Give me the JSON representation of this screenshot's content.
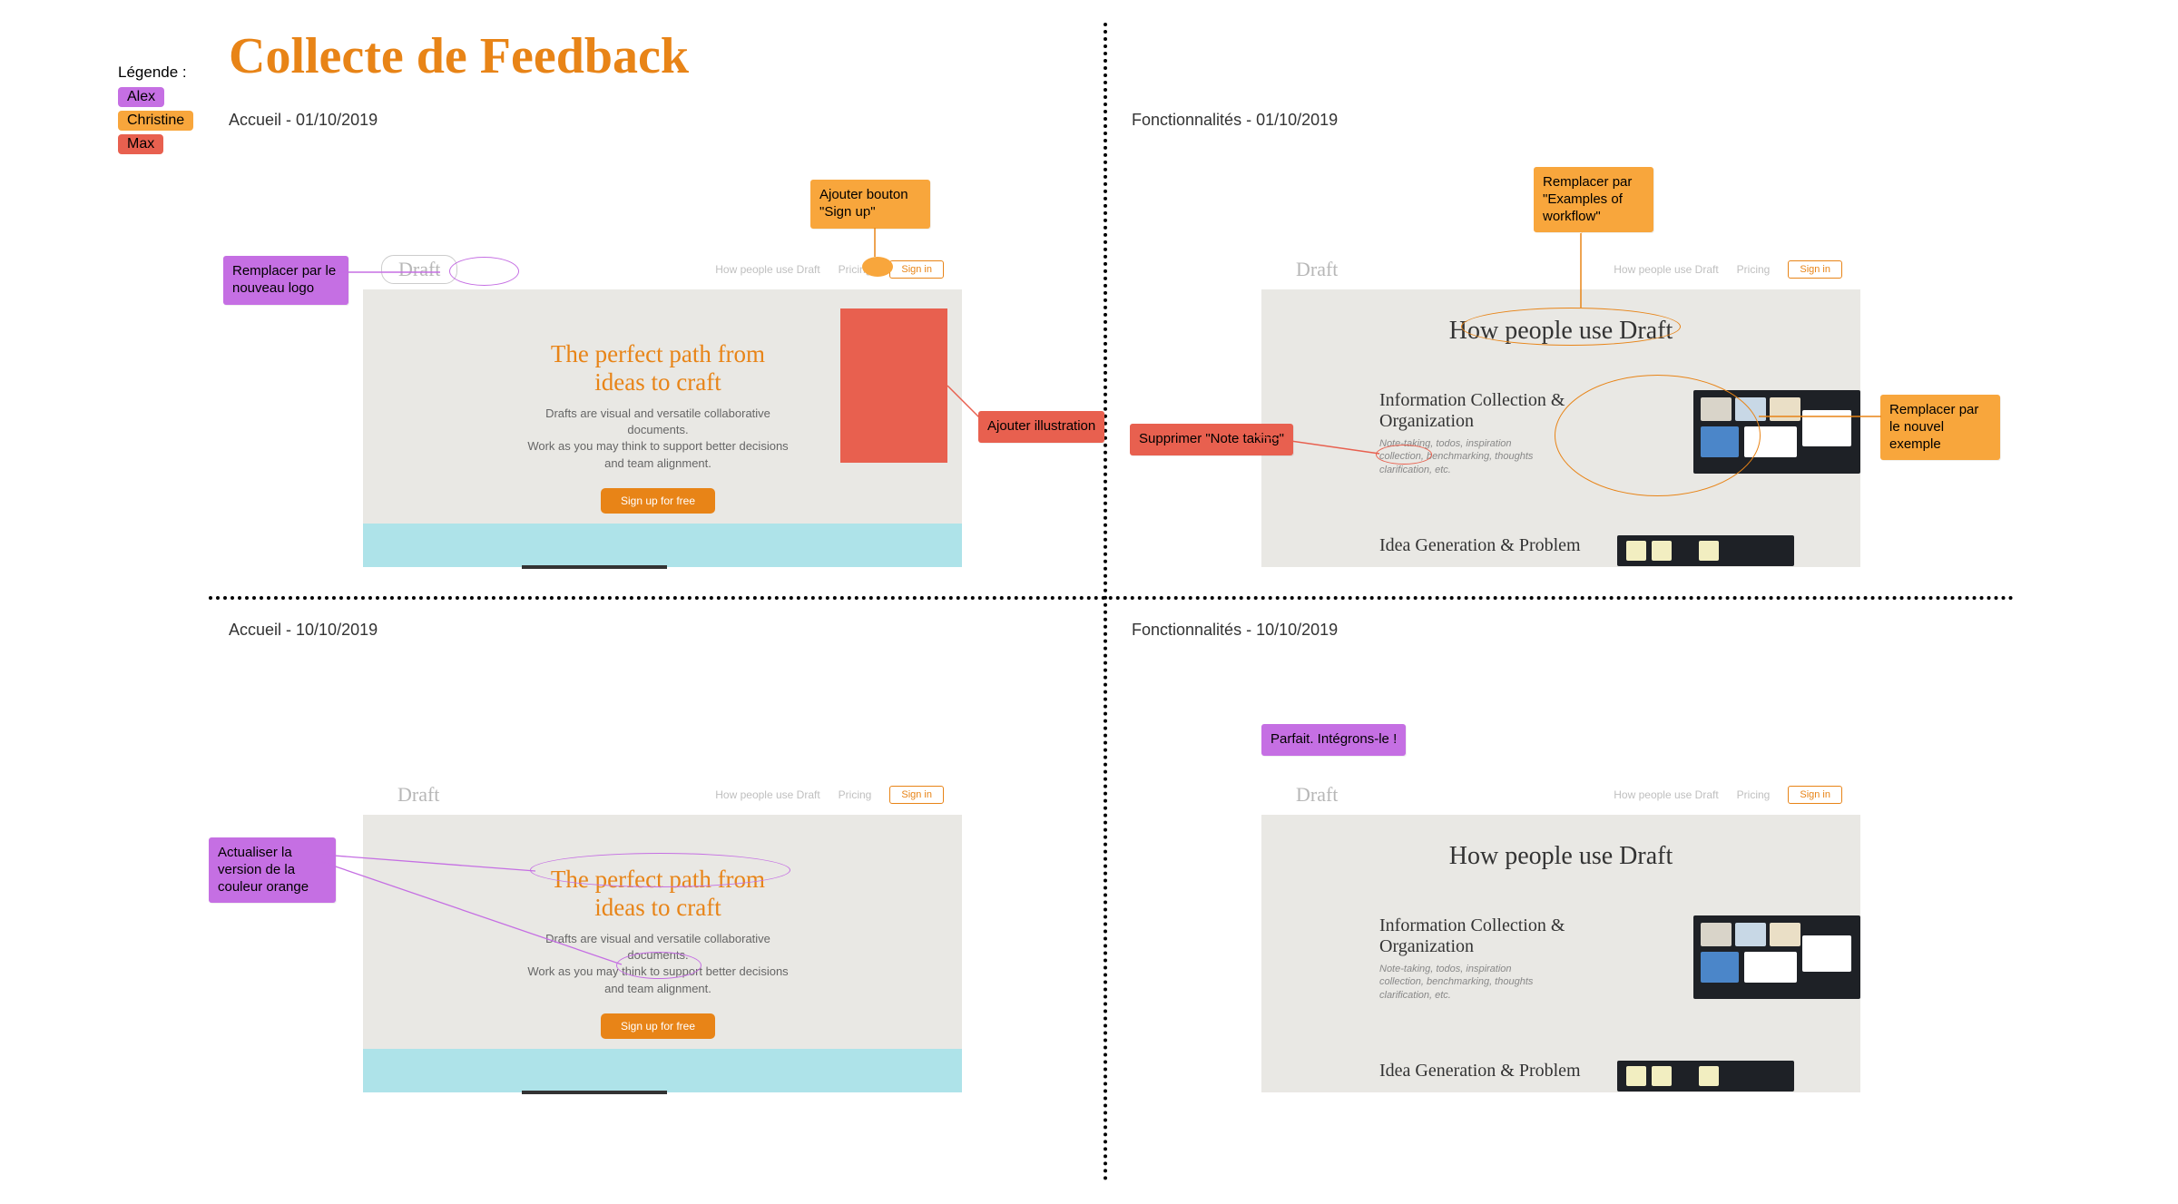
{
  "title": "Collecte de Feedback",
  "legend": {
    "label": "Légende :",
    "people": [
      "Alex",
      "Christine",
      "Max"
    ]
  },
  "sections": {
    "tl": "Accueil - 01/10/2019",
    "tr": "Fonctionnalités - 01/10/2019",
    "bl": "Accueil - 10/10/2019",
    "br": "Fonctionnalités - 10/10/2019"
  },
  "mock_home": {
    "logo": "Draft",
    "nav": {
      "how": "How people use Draft",
      "pricing": "Pricing",
      "signin": "Sign in"
    },
    "headline": "The perfect path from ideas to craft",
    "sub1": "Drafts are visual and versatile collaborative documents.",
    "sub2": "Work as you may think to support better decisions and team alignment.",
    "cta": "Sign up for free"
  },
  "mock_feat": {
    "title": "How people use Draft",
    "row1": {
      "h": "Information Collection & Organization",
      "p": "Note-taking, todos, inspiration collection, benchmarking, thoughts clarification, etc."
    },
    "row2": {
      "h": "Idea Generation & Problem"
    }
  },
  "notes": {
    "logo": "Remplacer par le nouveau logo",
    "signup": "Ajouter bouton \"Sign up\"",
    "illus": "Ajouter illustration",
    "workflow": "Remplacer par \"Examples of workflow\"",
    "example": "Remplacer par le nouvel exemple",
    "suppr": "Supprimer \"Note taking\"",
    "colour": "Actualiser la version de la couleur orange",
    "perfect": "Parfait. Intégrons-le !"
  }
}
